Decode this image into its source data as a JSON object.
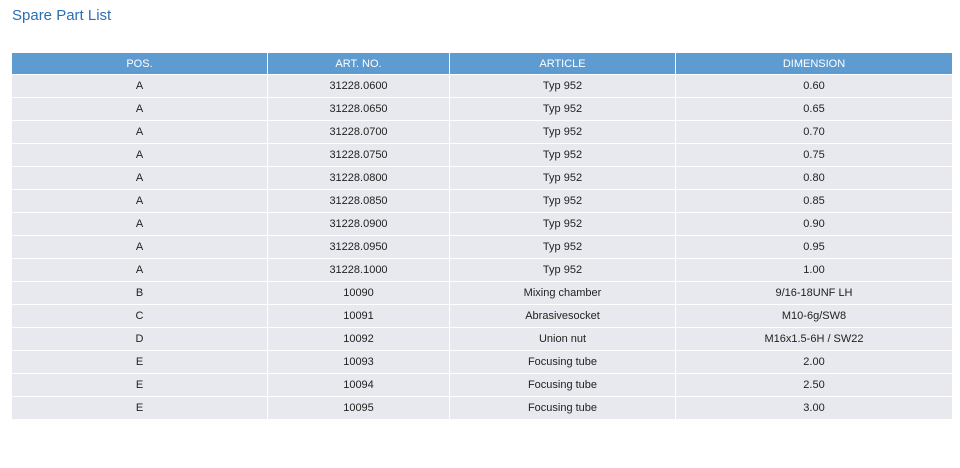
{
  "page": {
    "title": "Spare Part List"
  },
  "table": {
    "headers": [
      "POS.",
      "ART. NO.",
      "ARTICLE",
      "DIMENSION"
    ],
    "rows": [
      [
        "A",
        "31228.0600",
        "Typ 952",
        "0.60"
      ],
      [
        "A",
        "31228.0650",
        "Typ 952",
        "0.65"
      ],
      [
        "A",
        "31228.0700",
        "Typ 952",
        "0.70"
      ],
      [
        "A",
        "31228.0750",
        "Typ 952",
        "0.75"
      ],
      [
        "A",
        "31228.0800",
        "Typ 952",
        "0.80"
      ],
      [
        "A",
        "31228.0850",
        "Typ 952",
        "0.85"
      ],
      [
        "A",
        "31228.0900",
        "Typ 952",
        "0.90"
      ],
      [
        "A",
        "31228.0950",
        "Typ 952",
        "0.95"
      ],
      [
        "A",
        "31228.1000",
        "Typ 952",
        "1.00"
      ],
      [
        "B",
        "10090",
        "Mixing chamber",
        "9/16-18UNF LH"
      ],
      [
        "C",
        "10091",
        "Abrasivesocket",
        "M10-6g/SW8"
      ],
      [
        "D",
        "10092",
        "Union nut",
        "M16x1.5-6H / SW22"
      ],
      [
        "E",
        "10093",
        "Focusing tube",
        "2.00"
      ],
      [
        "E",
        "10094",
        "Focusing tube",
        "2.50"
      ],
      [
        "E",
        "10095",
        "Focusing tube",
        "3.00"
      ]
    ]
  },
  "colors": {
    "title": "#2a6fb4",
    "header_bg": "#5e9bd0",
    "row_bg": "#e8e9ef"
  }
}
